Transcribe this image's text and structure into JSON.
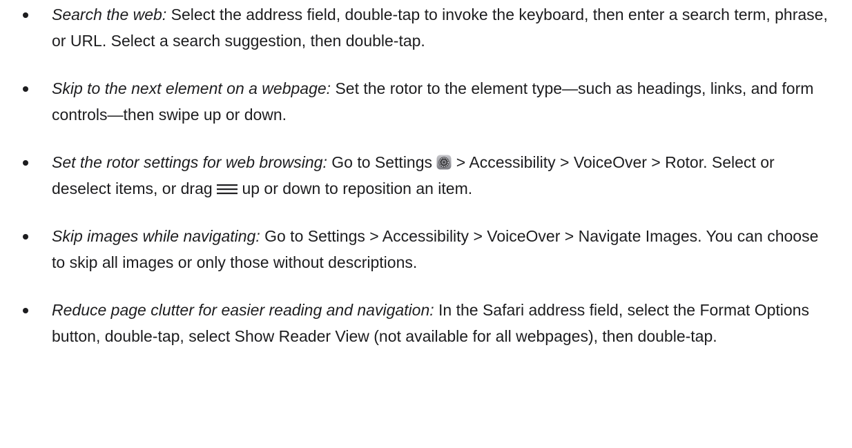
{
  "tips": [
    {
      "term": "Search the web:",
      "text": " Select the address field, double-tap to invoke the keyboard, then enter a search term, phrase, or URL. Select a search suggestion, then double-tap."
    },
    {
      "term": "Skip to the next element on a webpage:",
      "text": " Set the rotor to the element type—such as headings, links, and form controls—then swipe up or down."
    },
    {
      "term": "Set the rotor settings for web browsing:",
      "text_a": " Go to Settings ",
      "settings_icon": "settings-gear-icon",
      "text_b": " > Accessibility > VoiceOver > Rotor. Select or deselect items, or drag ",
      "reorder_icon": "reorder-handle-icon",
      "text_c": " up or down to reposition an item."
    },
    {
      "term": "Skip images while navigating:",
      "text": " Go to Settings > Accessibility > VoiceOver > Navigate Images. You can choose to skip all images or only those without descriptions."
    },
    {
      "term": "Reduce page clutter for easier reading and navigation:",
      "text": " In the Safari address field, select the Format Options button, double-tap, select Show Reader View (not available for all webpages), then double-tap."
    }
  ]
}
